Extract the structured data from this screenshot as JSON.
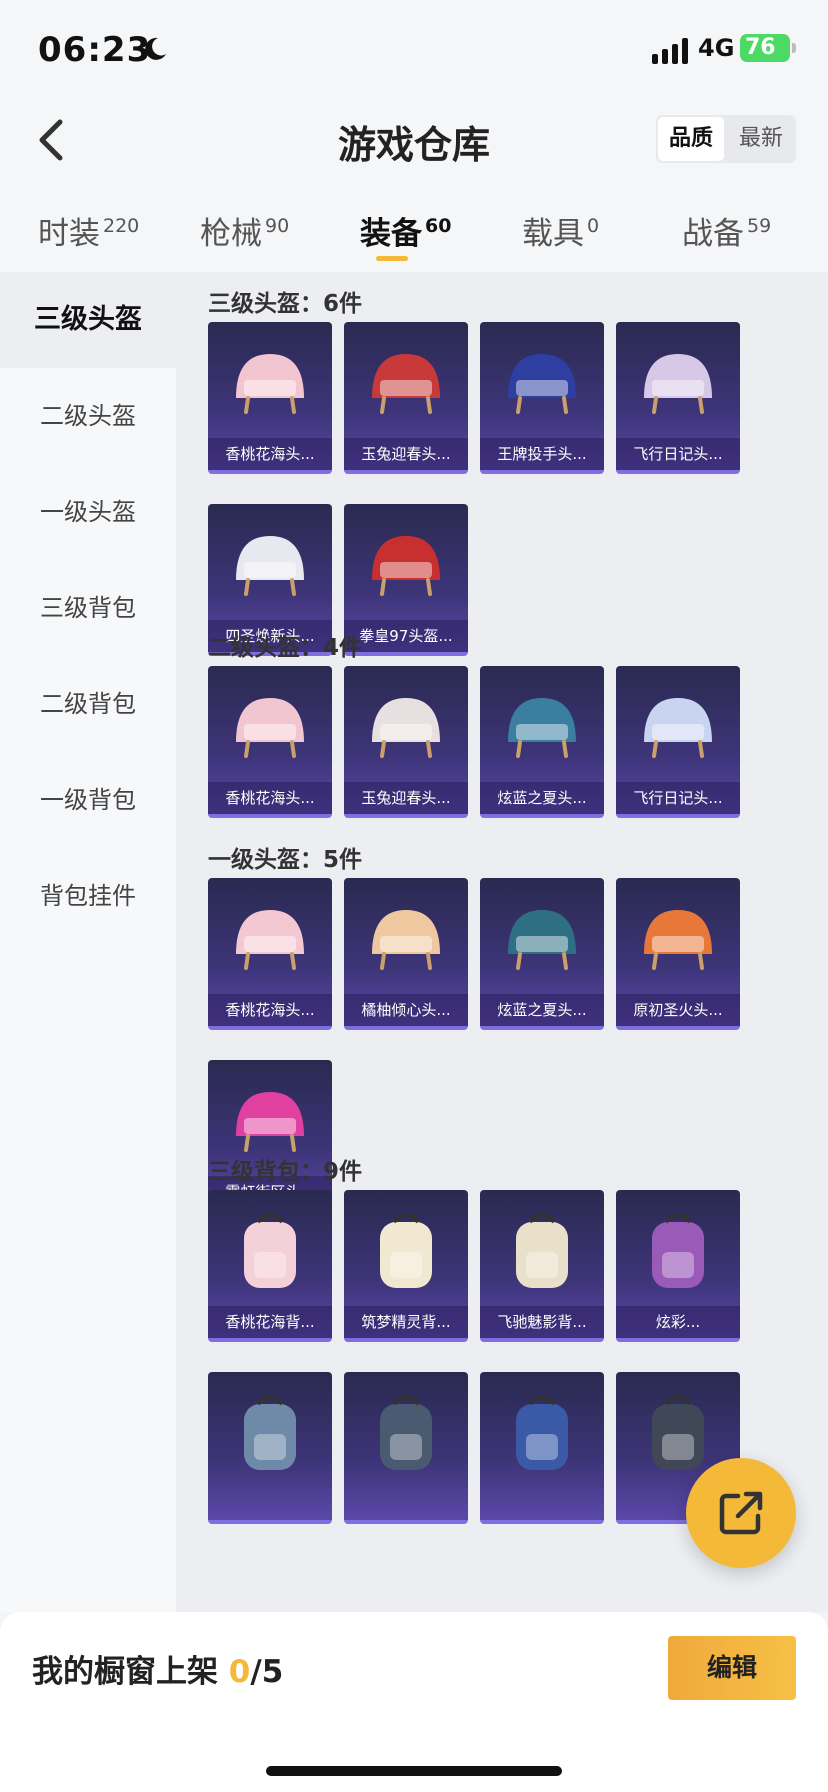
{
  "status_bar": {
    "time": "06:23",
    "network": "4G",
    "battery": "76"
  },
  "header": {
    "title": "游戏仓库",
    "sort_options": [
      "品质",
      "最新"
    ]
  },
  "tabs": [
    {
      "label": "时装",
      "count": "220"
    },
    {
      "label": "枪械",
      "count": "90"
    },
    {
      "label": "装备",
      "count": "60"
    },
    {
      "label": "载具",
      "count": "0"
    },
    {
      "label": "战备",
      "count": "59"
    }
  ],
  "sidebar": {
    "items": [
      {
        "label": "三级头盔"
      },
      {
        "label": "二级头盔"
      },
      {
        "label": "一级头盔"
      },
      {
        "label": "三级背包"
      },
      {
        "label": "二级背包"
      },
      {
        "label": "一级背包"
      },
      {
        "label": "背包挂件"
      }
    ]
  },
  "sections": [
    {
      "title": "三级头盔：6件",
      "items": [
        {
          "name": "香桃花海头...",
          "color": "#f2c6d0"
        },
        {
          "name": "玉兔迎春头...",
          "color": "#c83a3a"
        },
        {
          "name": "王牌投手头...",
          "color": "#2d3fa0"
        },
        {
          "name": "飞行日记头...",
          "color": "#d8c8e8"
        },
        {
          "name": "四圣焕新头...",
          "color": "#e8e8f0"
        },
        {
          "name": "拳皇97头盔...",
          "color": "#c83030"
        }
      ]
    },
    {
      "title": "二级头盔：4件",
      "items": [
        {
          "name": "香桃花海头...",
          "color": "#f2c6d0"
        },
        {
          "name": "玉兔迎春头...",
          "color": "#e8e0e0"
        },
        {
          "name": "炫蓝之夏头...",
          "color": "#3a7ea0"
        },
        {
          "name": "飞行日记头...",
          "color": "#c8d4f0"
        }
      ]
    },
    {
      "title": "一级头盔：5件",
      "items": [
        {
          "name": "香桃花海头...",
          "color": "#f4c8d2"
        },
        {
          "name": "橘柚倾心头...",
          "color": "#f0c8a0"
        },
        {
          "name": "炫蓝之夏头...",
          "color": "#2f6f84"
        },
        {
          "name": "原初圣火头...",
          "color": "#e8783a"
        },
        {
          "name": "霓虹街区头...",
          "color": "#e040a0"
        }
      ]
    },
    {
      "title": "三级背包：9件",
      "items": [
        {
          "name": "香桃花海背...",
          "color": "#f4d0d8"
        },
        {
          "name": "筑梦精灵背...",
          "color": "#f0e8d0"
        },
        {
          "name": "飞驰魅影背...",
          "color": "#e8e0c8"
        },
        {
          "name": "炫彩...",
          "color": "#9a5ab8"
        },
        {
          "name": "",
          "color": "#6e8aa8"
        },
        {
          "name": "",
          "color": "#4a5a70"
        },
        {
          "name": "",
          "color": "#3a5aa8"
        },
        {
          "name": "",
          "color": "#404858"
        }
      ]
    }
  ],
  "bottom_bar": {
    "showcase_label": "我的橱窗上架",
    "showcase_current": "0",
    "showcase_total": "/5",
    "edit_label": "编辑"
  },
  "colors": {
    "accent": "#f5b93a",
    "card_bg": "#3d3478"
  }
}
